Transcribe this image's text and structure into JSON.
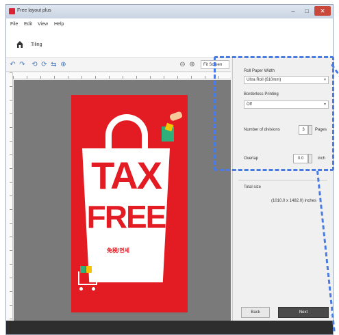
{
  "window": {
    "title": "Free layout plus",
    "controls": [
      "–",
      "□",
      "✕"
    ]
  },
  "menu": {
    "items": [
      "File",
      "Edit",
      "View",
      "Help"
    ]
  },
  "home": {
    "label": "Tiling"
  },
  "toolbar": {
    "icons": [
      "undo-icon",
      "redo-icon",
      "rotate-left-icon",
      "rotate-right-icon",
      "flip-icon",
      "fit-icon",
      "zoom-out-icon",
      "zoom-in-icon"
    ],
    "zoom_value": "Fit Screen"
  },
  "poster": {
    "line1": "TAX",
    "line2": "FREE",
    "sub": "免税/면세",
    "colors": {
      "background": "#e31b23",
      "bag": "#ffffff"
    }
  },
  "panel": {
    "roll_width_label": "Roll Paper Width",
    "roll_width_value": "Ultra Roll (610mm)",
    "borderless_label": "Borderless Printing",
    "borderless_value": "Off",
    "divisions_label": "Number of divisions",
    "divisions_value": "3",
    "divisions_unit": "Pages",
    "overlap_label": "Overlap",
    "overlap_value": "0.0",
    "overlap_unit": "inch",
    "total_size_label": "Total size",
    "total_size_value": "(1010.0 x 1482.0) inches",
    "back_label": "Back",
    "next_label": "Next"
  },
  "colors": {
    "accent": "#4a7be0",
    "canvas": "#7a7a7a"
  }
}
